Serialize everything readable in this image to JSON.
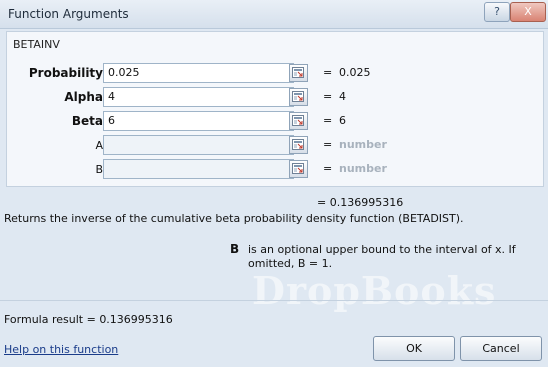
{
  "window": {
    "title": "Function Arguments",
    "help_label": "?",
    "close_label": "X"
  },
  "function_name": "BETAINV",
  "arguments": [
    {
      "label": "Probability",
      "value": "0.025",
      "result": "0.025",
      "bold": true
    },
    {
      "label": "Alpha",
      "value": "4",
      "result": "4",
      "bold": true
    },
    {
      "label": "Beta",
      "value": "6",
      "result": "6",
      "bold": true
    },
    {
      "label": "A",
      "value": "",
      "result": "number",
      "bold": false
    },
    {
      "label": "B",
      "value": "",
      "result": "number",
      "bold": false
    }
  ],
  "equals": "=",
  "result_value": "0.136995316",
  "description": "Returns the inverse of the cumulative beta probability density function (BETADIST).",
  "argument_help": {
    "name": "B",
    "text": "is an optional upper bound to the interval of x. If omitted, B = 1."
  },
  "formula_result": {
    "label": "Formula result =",
    "value": "0.136995316"
  },
  "help_link": "Help on this function",
  "buttons": {
    "ok": "OK",
    "cancel": "Cancel"
  },
  "watermark": "DropBooks",
  "colors": {
    "panel_bg": "#f4f7fb",
    "dialog_bg": "#dfe8f2",
    "link": "#1a3c8a"
  }
}
